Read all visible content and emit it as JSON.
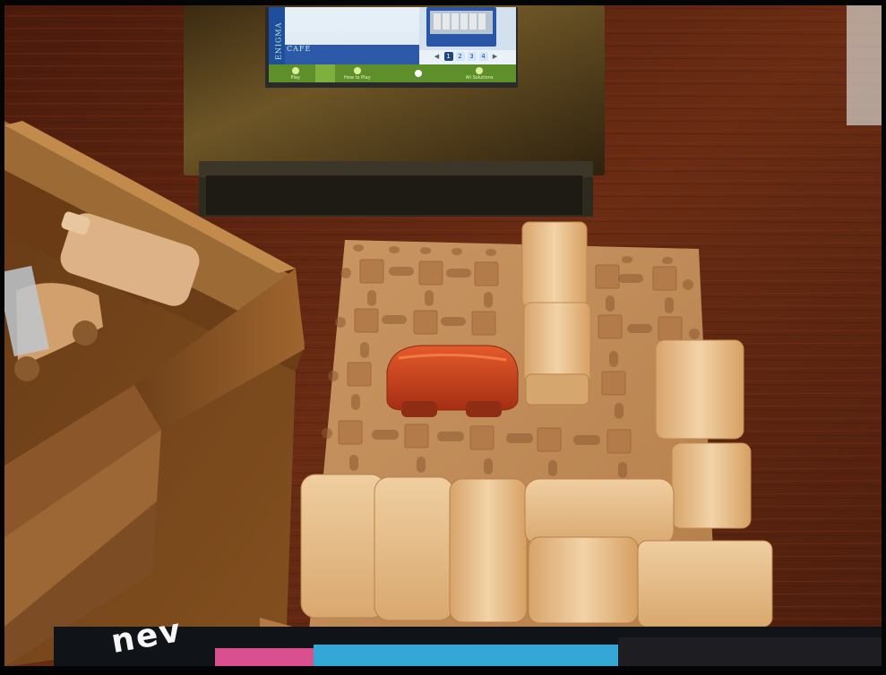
{
  "scene": {
    "description": "",
    "screen": {
      "vertical_title": "ENIGMA",
      "cafe_label": "CAFÉ",
      "pager": {
        "left_arrow": "◀",
        "right_arrow": "▶",
        "pages": [
          "1",
          "2",
          "3",
          "4"
        ],
        "active_page": "1"
      },
      "tabs": [
        {
          "label": "Play"
        },
        {
          "label": "How to Play"
        },
        {
          "label": ""
        },
        {
          "label": "All Solutions"
        }
      ]
    },
    "mat_text": "nev"
  },
  "colors": {
    "table": "#5b2510",
    "box": "#7d4a1f",
    "board": "#c48d59",
    "wood": "#e5bd8a",
    "red_car": "#c63b1c",
    "screen_green": "#5e8f2a",
    "screen_blue": "#1f4f9c"
  }
}
